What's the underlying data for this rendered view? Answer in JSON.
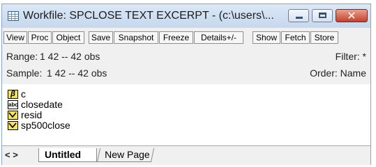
{
  "window": {
    "title": "Workfile: SPCLOSE TEXT EXCERPT - (c:\\users\\...",
    "close_glyph": "✕"
  },
  "toolbar": {
    "buttons": [
      "View",
      "Proc",
      "Object",
      "Save",
      "Snapshot",
      "Freeze",
      "Details+/-",
      "Show",
      "Fetch",
      "Store"
    ]
  },
  "info": {
    "range_label": "Range:",
    "range_value": "1 42  --  42 obs",
    "sample_label": "Sample:",
    "sample_value": "1 42  --  42 obs",
    "filter": "Filter: *",
    "order": "Order: Name"
  },
  "objects": [
    {
      "name": "c",
      "icon": "coefficient-icon"
    },
    {
      "name": "closedate",
      "icon": "alpha-series-icon"
    },
    {
      "name": "resid",
      "icon": "series-icon"
    },
    {
      "name": "sp500close",
      "icon": "series-icon"
    }
  ],
  "tabs": {
    "nav": "< >",
    "active": "Untitled",
    "inactive": "New Page"
  },
  "colors": {
    "icon_yellow": "#f5e35a",
    "close_red": "#c4402c",
    "titlebar": "#c6d8ee"
  }
}
